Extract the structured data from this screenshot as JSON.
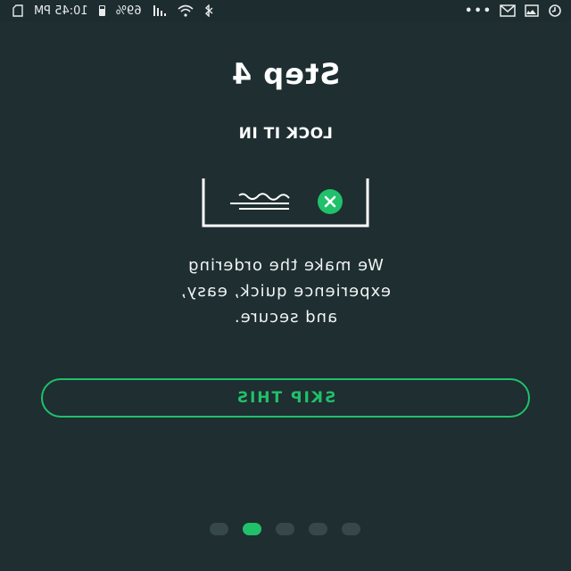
{
  "status_bar": {
    "time": "10:45 PM",
    "battery_percent": "69%",
    "icons": [
      "sim-icon",
      "battery-icon",
      "signal-icon",
      "wifi-icon",
      "bluetooth-icon",
      "more-dots-icon",
      "mail-icon",
      "gallery-icon",
      "refresh-icon"
    ]
  },
  "onboarding": {
    "title": "Step 4",
    "subtitle": "LOCK IT IN",
    "description_lines": [
      "We make the ordering",
      "experience quick, easy,",
      "and secure."
    ],
    "skip_label": "SKIP THIS",
    "total_steps": 5,
    "active_step": 4
  },
  "colors": {
    "background": "#1e2e31",
    "accent": "#21c06a",
    "inactive_dot": "#37484b",
    "text": "#ffffff"
  }
}
